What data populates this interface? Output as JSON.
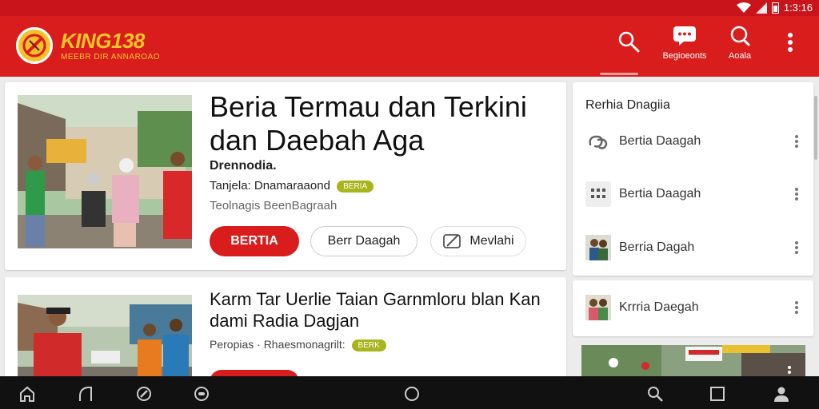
{
  "status_bar": {
    "time": "1:3:16",
    "icons": [
      "wifi-icon",
      "signal-icon",
      "battery-icon"
    ]
  },
  "app_bar": {
    "logo_title": "KING138",
    "logo_subtitle": "MEEBR DIR ANNAROAO",
    "actions": [
      {
        "icon": "search-icon",
        "label": ""
      },
      {
        "icon": "chat-icon",
        "label": "Begioeonts"
      },
      {
        "icon": "notification-icon",
        "label": "Aoala"
      },
      {
        "icon": "more-vert-icon",
        "label": ""
      }
    ]
  },
  "articles": [
    {
      "headline": "Beria Termau dan Terkini dan Daebah Aga",
      "source": "Drennodia.",
      "meta": "Tanjela: Dnamaraaond",
      "badge": "BERIA",
      "sub_meta": "Teolnagis BeenBagraah",
      "buttons": {
        "primary": "BERTIA",
        "secondary": "Berr Daagah",
        "tertiary": "Mevlahi"
      }
    },
    {
      "headline": "Karm Tar Uerlie Taian Garnmloru blan Kan dami Radia Dagjan",
      "meta": "Peropias · Rhaesmonagrilt:",
      "badge": "BERK"
    }
  ],
  "sidebar": {
    "title": "Rerhia Dnagiia",
    "items": [
      {
        "icon": "link-icon",
        "label": "Bertia Daagah"
      },
      {
        "icon": "grid-icon",
        "label": "Bertia Daagah"
      },
      {
        "icon": "people-photo-icon",
        "label": "Berria Dagah"
      },
      {
        "icon": "people-photo-icon",
        "label": "Krrria Daegah"
      }
    ]
  },
  "nav_bar": {
    "icons": [
      "home-icon",
      "music-icon",
      "compass-icon",
      "record-icon",
      "circle-home-icon",
      "search-icon",
      "square-icon",
      "profile-icon"
    ]
  },
  "colors": {
    "brand_red": "#d91d1d",
    "status_red": "#c8141a",
    "logo_gold": "#f6c428",
    "badge_green": "#a8b51c",
    "nav_black": "#111111"
  }
}
